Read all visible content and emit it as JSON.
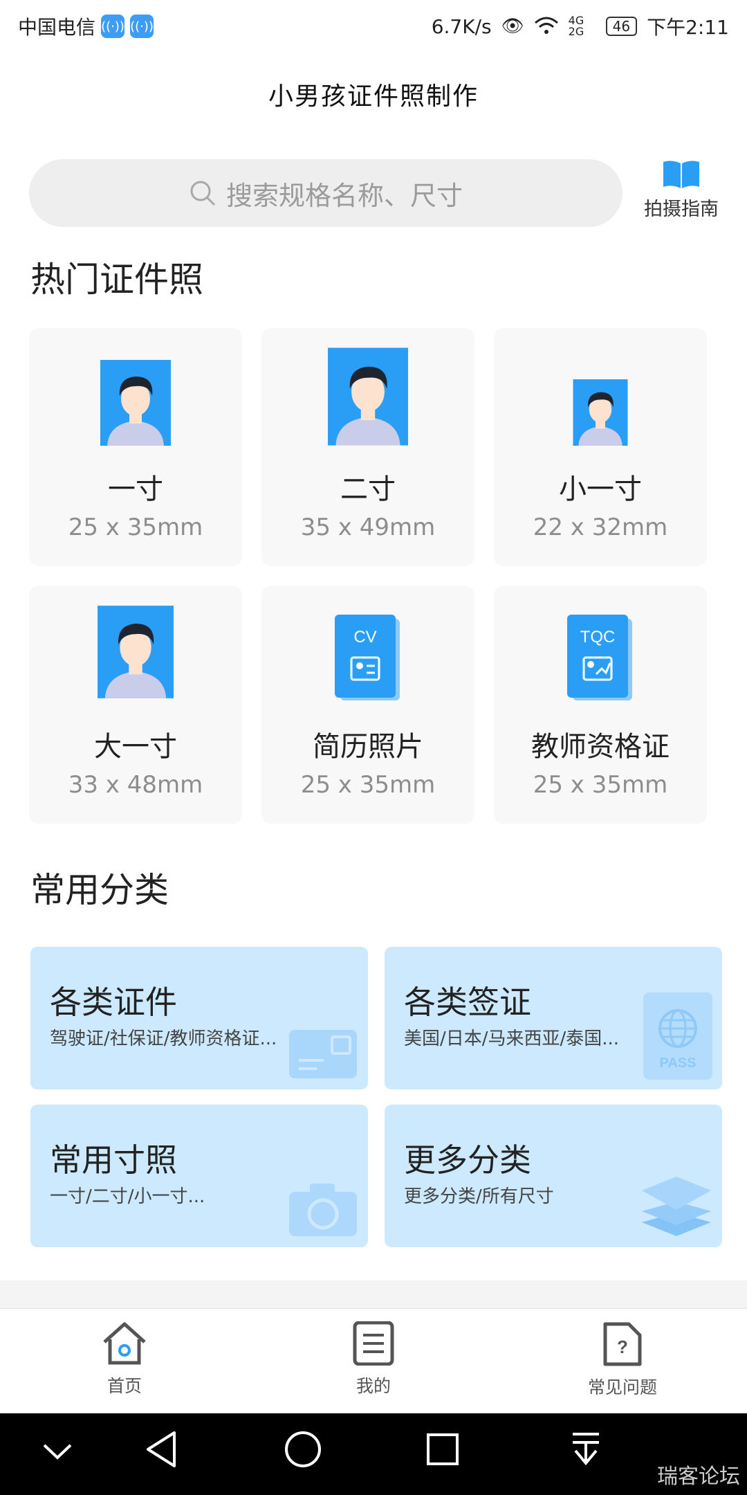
{
  "status_bar": {
    "carrier": "中国电信",
    "speed": "6.7K/s",
    "network": "4G 2G",
    "battery": "46",
    "time": "下午2:11"
  },
  "header": {
    "title": "小男孩证件照制作"
  },
  "search": {
    "placeholder": "搜索规格名称、尺寸"
  },
  "guide": {
    "label": "拍摄指南"
  },
  "hot_section": {
    "title": "热门证件照",
    "items": [
      {
        "name": "一寸",
        "size": "25 x 35mm",
        "icon": "portrait-icon"
      },
      {
        "name": "二寸",
        "size": "35 x 49mm",
        "icon": "portrait-icon"
      },
      {
        "name": "小一寸",
        "size": "22 x 32mm",
        "icon": "portrait-icon"
      },
      {
        "name": "大一寸",
        "size": "33 x 48mm",
        "icon": "portrait-icon"
      },
      {
        "name": "简历照片",
        "size": "25 x 35mm",
        "icon": "cv-card-icon",
        "badge": "CV"
      },
      {
        "name": "教师资格证",
        "size": "25 x 35mm",
        "icon": "tqc-card-icon",
        "badge": "TQC"
      }
    ]
  },
  "category_section": {
    "title": "常用分类",
    "items": [
      {
        "title": "各类证件",
        "subtitle": "驾驶证/社保证/教师资格证...",
        "icon": "id-card-icon"
      },
      {
        "title": "各类签证",
        "subtitle": "美国/日本/马来西亚/泰国...",
        "icon": "passport-icon",
        "icon_text": "PASS"
      },
      {
        "title": "常用寸照",
        "subtitle": "一寸/二寸/小一寸...",
        "icon": "camera-icon"
      },
      {
        "title": "更多分类",
        "subtitle": "更多分类/所有尺寸",
        "icon": "layers-icon"
      }
    ]
  },
  "tabbar": {
    "items": [
      {
        "label": "首页",
        "icon": "home-icon",
        "active": true
      },
      {
        "label": "我的",
        "icon": "document-icon"
      },
      {
        "label": "常见问题",
        "icon": "help-file-icon"
      }
    ]
  },
  "system_nav": {
    "watermark": "瑞客论坛"
  },
  "colors": {
    "accent": "#2a9df4",
    "category_bg": "#cde9fe",
    "card_bg": "#f8f8f8",
    "search_bg": "#eeeeee"
  }
}
